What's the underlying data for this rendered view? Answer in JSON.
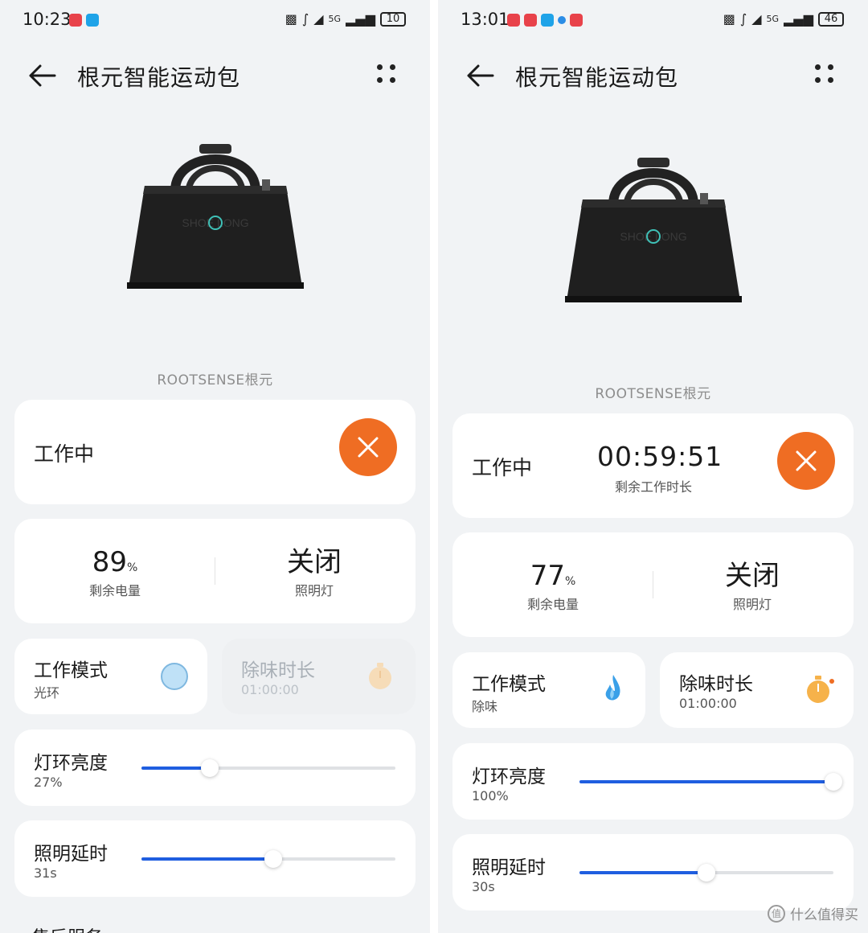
{
  "left": {
    "status_bar": {
      "time": "10:23",
      "battery": "10",
      "network": "5G"
    },
    "nav": {
      "title": "根元智能运动包"
    },
    "product": {
      "brand": "ROOTSENSE根元",
      "bag_print": "SHOE LONG"
    },
    "status_card": {
      "label": "工作中",
      "stop_icon": "close-icon"
    },
    "stats": {
      "battery_value": "89",
      "battery_unit": "%",
      "battery_label": "剩余电量",
      "light_value": "关闭",
      "light_label": "照明灯"
    },
    "mode_tile": {
      "title": "工作模式",
      "value": "光环",
      "icon": "halo-circle-icon"
    },
    "deodor_tile": {
      "title": "除味时长",
      "value": "01:00:00",
      "icon": "timer-icon",
      "disabled": true
    },
    "brightness": {
      "title": "灯环亮度",
      "value": "27%",
      "level": 0.27
    },
    "delay": {
      "title": "照明延时",
      "value": "31s",
      "level": 0.52
    },
    "next_section": "售后服务"
  },
  "right": {
    "status_bar": {
      "time": "13:01",
      "battery": "46",
      "network": "5G"
    },
    "nav": {
      "title": "根元智能运动包"
    },
    "product": {
      "brand": "ROOTSENSE根元",
      "bag_print": "SHOE LONG"
    },
    "status_card": {
      "label": "工作中",
      "timer": "00:59:51",
      "timer_caption": "剩余工作时长",
      "stop_icon": "close-icon"
    },
    "stats": {
      "battery_value": "77",
      "battery_unit": "%",
      "battery_label": "剩余电量",
      "light_value": "关闭",
      "light_label": "照明灯"
    },
    "mode_tile": {
      "title": "工作模式",
      "value": "除味",
      "icon": "flame-icon"
    },
    "deodor_tile": {
      "title": "除味时长",
      "value": "01:00:00",
      "icon": "timer-icon",
      "disabled": false
    },
    "brightness": {
      "title": "灯环亮度",
      "value": "100%",
      "level": 1.0
    },
    "delay": {
      "title": "照明延时",
      "value": "30s",
      "level": 0.5
    }
  },
  "watermark": {
    "text": "什么值得买",
    "badge": "值"
  },
  "colors": {
    "accent": "#ef6d23",
    "slider_fill": "#1f5ee0",
    "background": "#f1f3f5",
    "card": "#ffffff"
  }
}
